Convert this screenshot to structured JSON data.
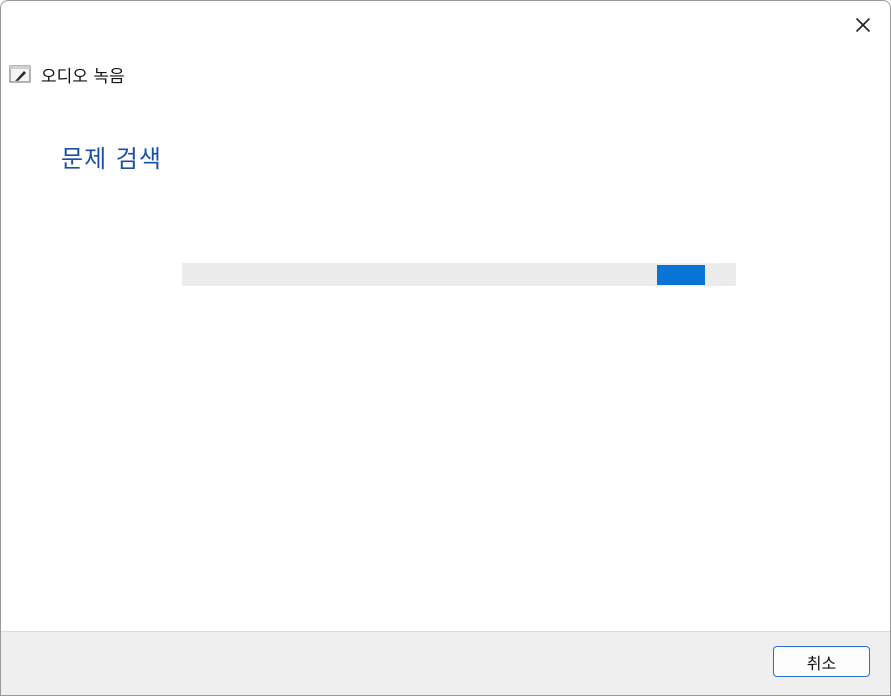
{
  "window": {
    "close_icon": "close-icon"
  },
  "app": {
    "title": "오디오 녹음",
    "icon": "troubleshooter-icon"
  },
  "page": {
    "heading": "문제 검색"
  },
  "progress": {
    "mode": "indeterminate",
    "indicator_position_fraction": 0.9,
    "accent_color": "#0a74d6"
  },
  "footer": {
    "cancel_label": "취소"
  },
  "colors": {
    "heading": "#1a4fa8",
    "accent": "#0a74d6",
    "footer_bg": "#efefef",
    "button_border": "#2a6fd0"
  }
}
